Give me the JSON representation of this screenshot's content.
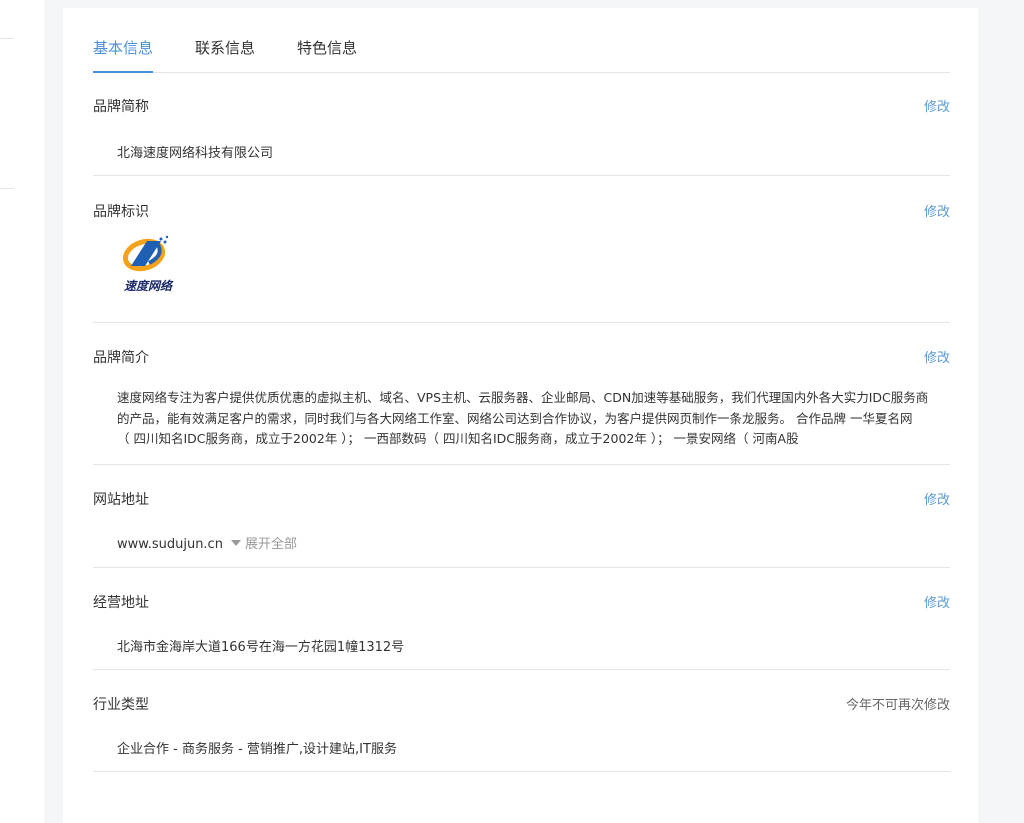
{
  "tabs": [
    {
      "label": "基本信息",
      "active": true
    },
    {
      "label": "联系信息",
      "active": false
    },
    {
      "label": "特色信息",
      "active": false
    }
  ],
  "edit_label": "修改",
  "brand_short": {
    "title": "品牌简称",
    "value": "北海速度网络科技有限公司"
  },
  "brand_logo": {
    "title": "品牌标识",
    "logo_text": "速度网络"
  },
  "brand_intro": {
    "title": "品牌简介",
    "lines": [
      "速度网络专注为客户提供优质优惠的虚拟主机、域名、VPS主机、云服务器、企业邮局、CDN加速等基础服务，我们代理国内外各大实力IDC服务商",
      "的产品，能有效满足客户的需求，同时我们与各大网络工作室、网络公司达到合作协议，为客户提供网页制作一条龙服务。 合作品牌 一华夏名网",
      "（ 四川知名IDC服务商，成立于2002年 ）； 一西部数码（ 四川知名IDC服务商，成立于2002年 ）； 一景安网络（ 河南A股"
    ]
  },
  "website": {
    "title": "网站地址",
    "value": "www.sudujun.cn",
    "expand_label": "展开全部"
  },
  "address": {
    "title": "经营地址",
    "value": "北海市金海岸大道166号在海一方花园1幢1312号"
  },
  "industry": {
    "title": "行业类型",
    "note": "今年不可再次修改",
    "value": "企业合作 - 商务服务 - 营销推广,设计建站,IT服务"
  },
  "colors": {
    "accent": "#4a90d9",
    "edit": "#5b9bd5",
    "logo_orange": "#f5a21b",
    "logo_blue": "#1f5fb4"
  }
}
